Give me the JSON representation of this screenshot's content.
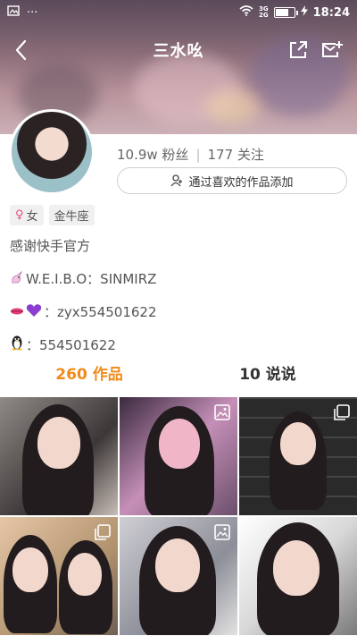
{
  "status_bar": {
    "time": "18:24",
    "net_top": "3G",
    "net_bottom": "2G",
    "battery_level": 0.75
  },
  "header": {
    "title": "三水吆"
  },
  "profile": {
    "followers": "10.9w 粉丝",
    "following": "177 关注",
    "add_button_label": "通过喜欢的作品添加",
    "tags": [
      {
        "label": "女"
      },
      {
        "label": "金牛座"
      }
    ],
    "bio": {
      "line1": "感谢快手官方",
      "line2": "W.E.I.B.O：SINMIRZ",
      "line3": "：zyx554501622",
      "line4": "：554501622"
    }
  },
  "tabs": {
    "works": "260 作品",
    "says": "10 说说"
  },
  "colors": {
    "accent": "#f08a1a",
    "female": "#e84d86"
  }
}
